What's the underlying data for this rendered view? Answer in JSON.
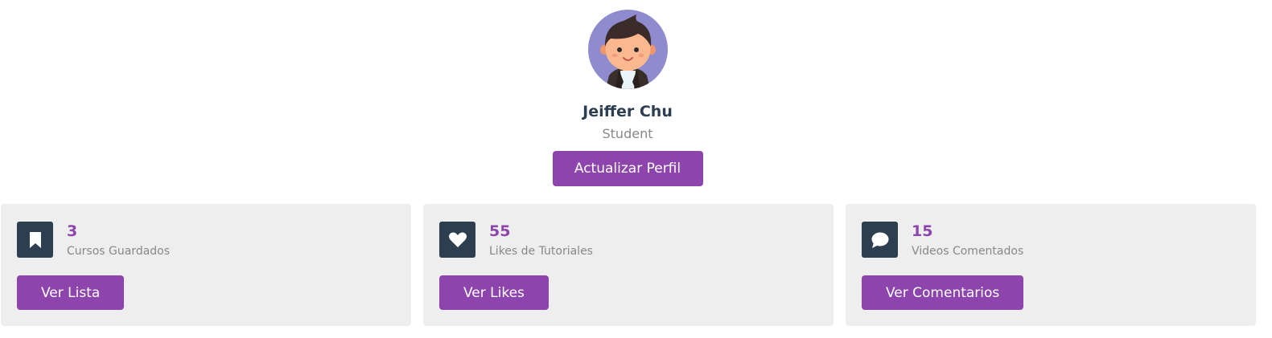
{
  "profile": {
    "name": "Jeiffer Chu",
    "role": "Student",
    "update_button": "Actualizar Perfil"
  },
  "cards": [
    {
      "icon": "bookmark-icon",
      "value": "3",
      "label": "Cursos Guardados",
      "button": "Ver Lista"
    },
    {
      "icon": "heart-icon",
      "value": "55",
      "label": "Likes de Tutoriales",
      "button": "Ver Likes"
    },
    {
      "icon": "comment-icon",
      "value": "15",
      "label": "Videos Comentados",
      "button": "Ver Comentarios"
    }
  ],
  "colors": {
    "accent": "#8e44ad",
    "icon_bg": "#2c3e50",
    "card_bg": "#eeeeee",
    "avatar_bg": "#8e8bcf"
  }
}
